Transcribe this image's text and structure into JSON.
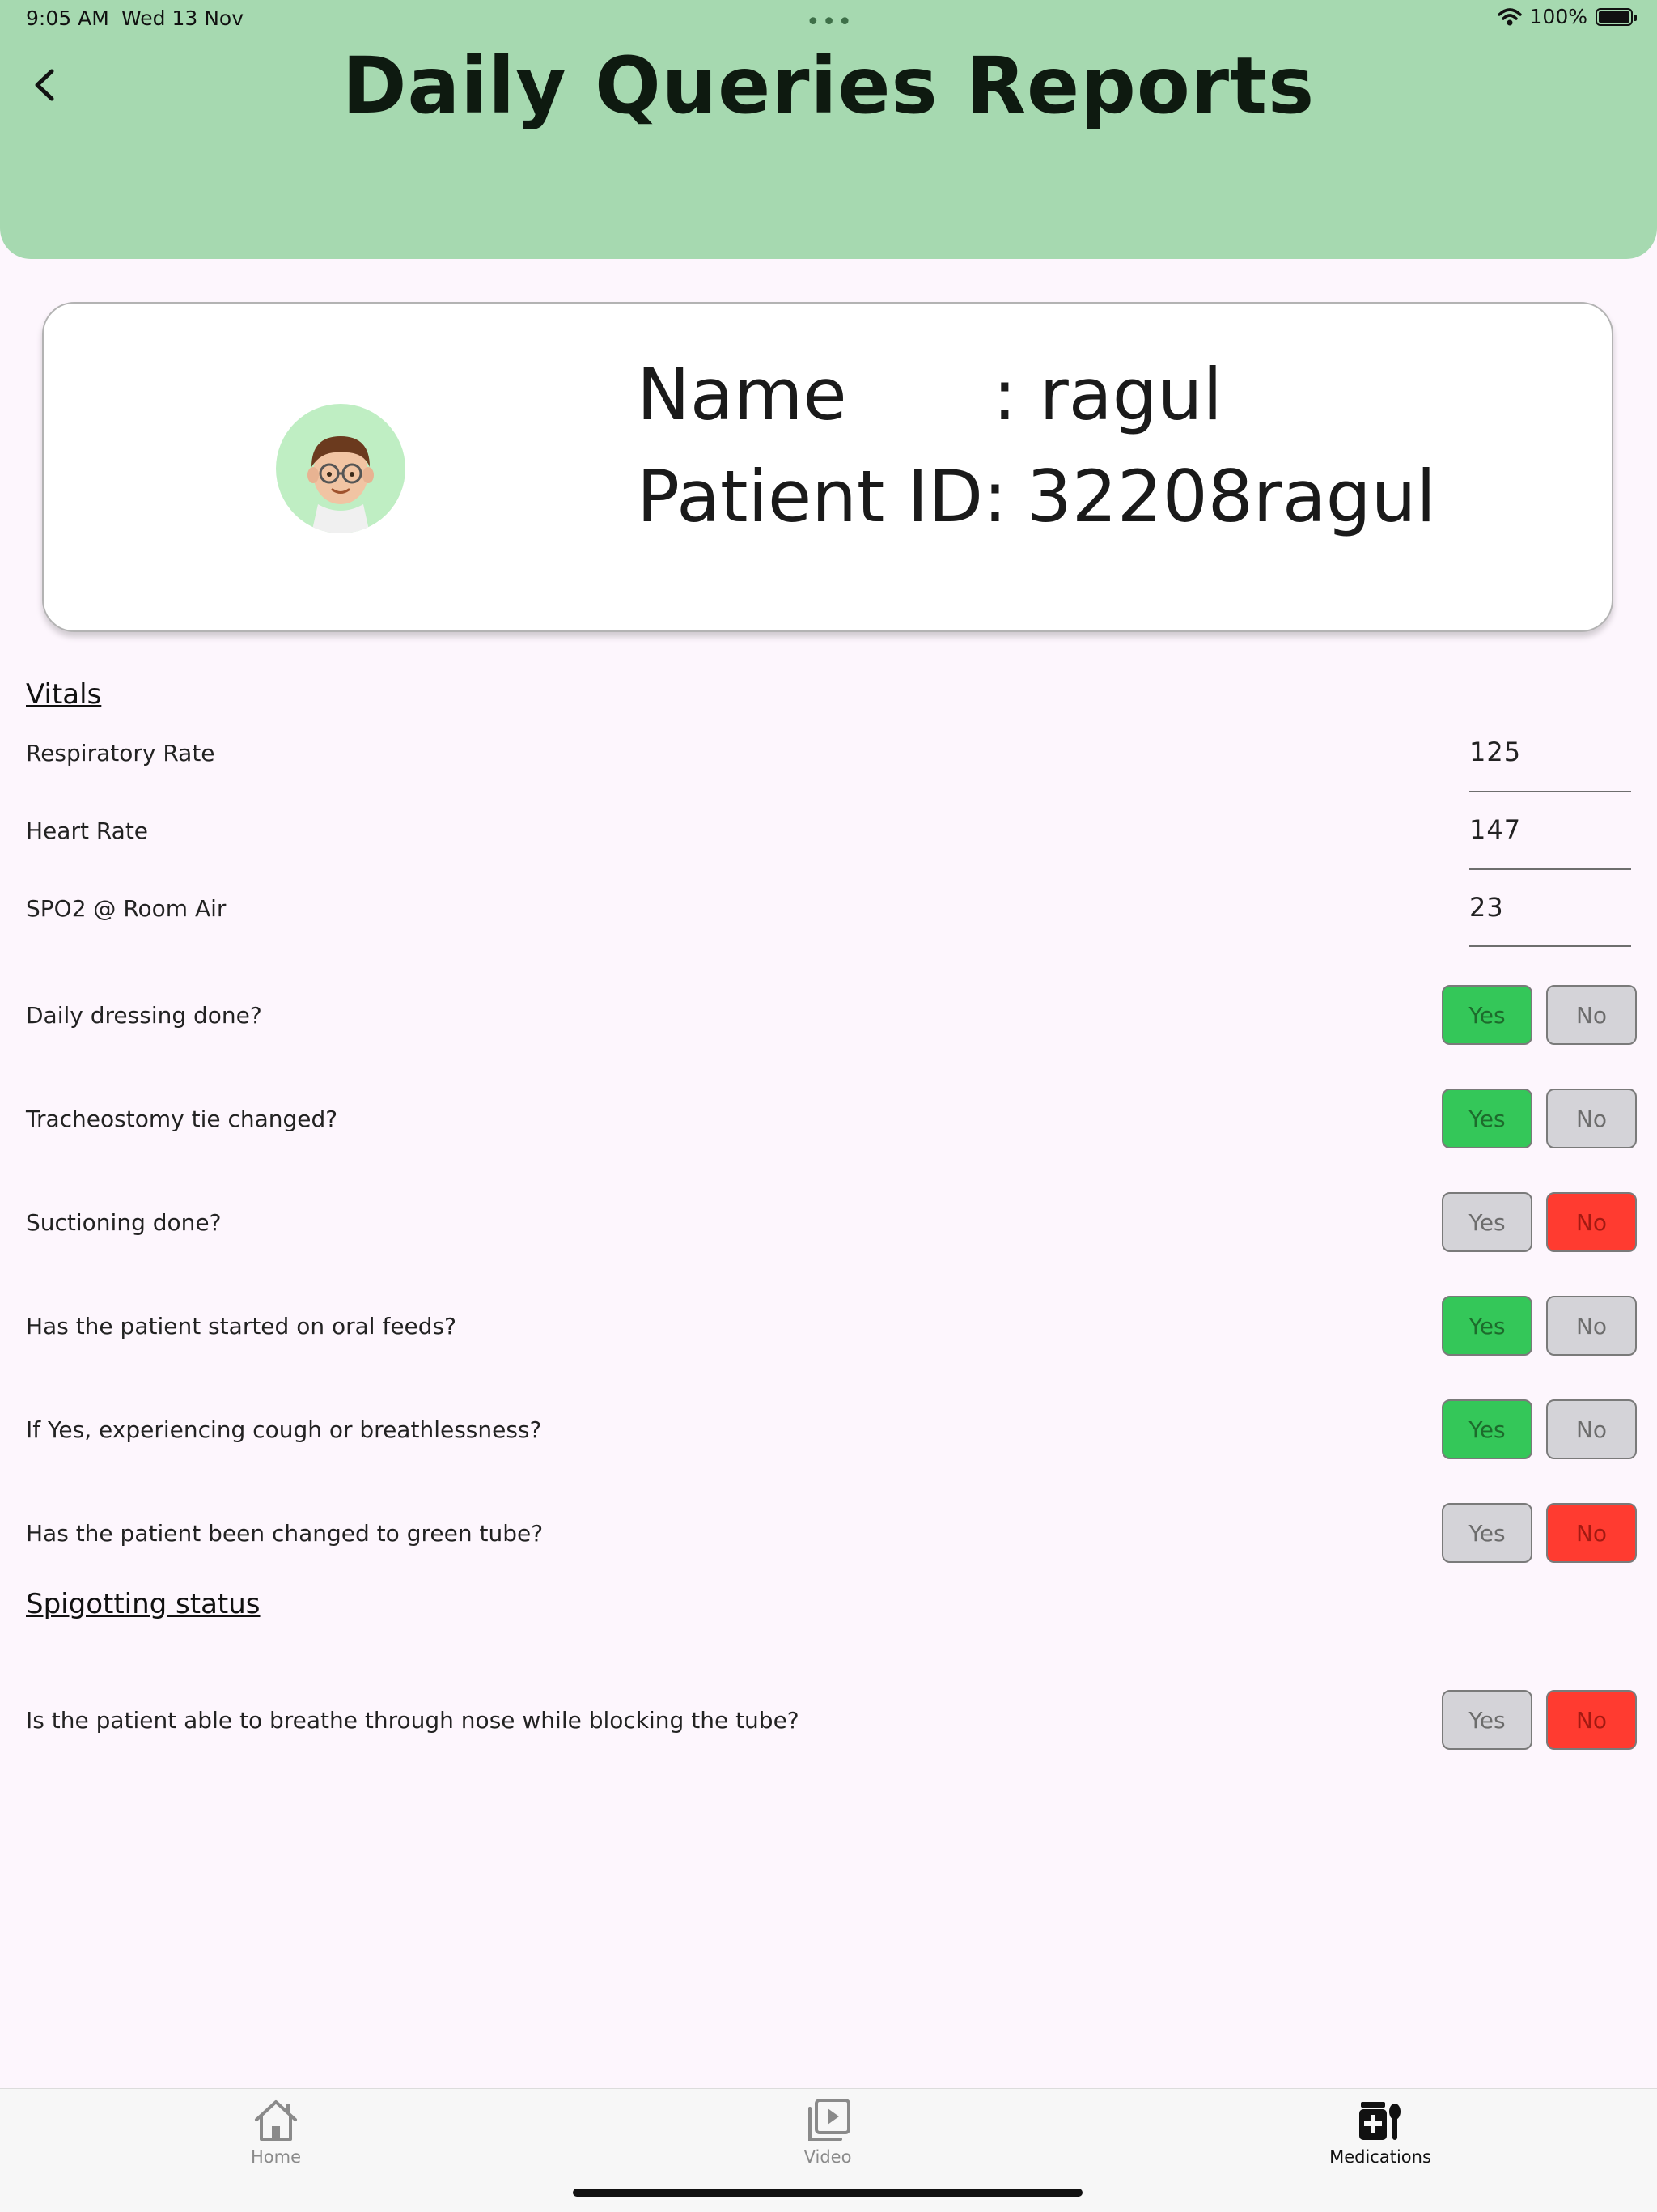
{
  "status_bar": {
    "time": "9:05 AM",
    "date": "Wed 13 Nov",
    "battery": "100%"
  },
  "header": {
    "title": "Daily Queries Reports",
    "background": "#a6d9b0"
  },
  "patient": {
    "name_label": "Name",
    "name_separator": ": ragul",
    "id_label": "Patient ID:",
    "id_value": "32208ragul",
    "avatar_icon": "memoji-avatar"
  },
  "vitals": {
    "title": "Vitals",
    "items": [
      {
        "label": "Respiratory Rate",
        "value": "125"
      },
      {
        "label": "Heart Rate",
        "value": "147"
      },
      {
        "label": "SPO2 @ Room Air",
        "value": "23"
      }
    ]
  },
  "questions": [
    {
      "label": "Daily dressing done?",
      "yes": "Yes",
      "no": "No",
      "answer": "yes"
    },
    {
      "label": "Tracheostomy tie changed?",
      "yes": "Yes",
      "no": "No",
      "answer": "yes"
    },
    {
      "label": "Suctioning done?",
      "yes": "Yes",
      "no": "No",
      "answer": "no"
    },
    {
      "label": "Has the patient started on oral feeds?",
      "yes": "Yes",
      "no": "No",
      "answer": "yes"
    },
    {
      "label": "If Yes, experiencing cough or breathlessness?",
      "yes": "Yes",
      "no": "No",
      "answer": "yes"
    },
    {
      "label": "Has the patient been changed to green tube?",
      "yes": "Yes",
      "no": "No",
      "answer": "no"
    }
  ],
  "spigotting": {
    "title": "Spigotting status",
    "questions": [
      {
        "label": "Is the patient able to breathe through nose while blocking the tube?",
        "yes": "Yes",
        "no": "No",
        "answer": "no"
      }
    ]
  },
  "colors": {
    "yes_selected": "#34c759",
    "no_selected": "#ff3b30",
    "unselected": "#d4d3d8"
  },
  "tabbar": {
    "tabs": [
      {
        "label": "Home",
        "icon": "home-icon",
        "active": false
      },
      {
        "label": "Video",
        "icon": "video-library-icon",
        "active": false
      },
      {
        "label": "Medications",
        "icon": "medications-icon",
        "active": true
      }
    ]
  }
}
